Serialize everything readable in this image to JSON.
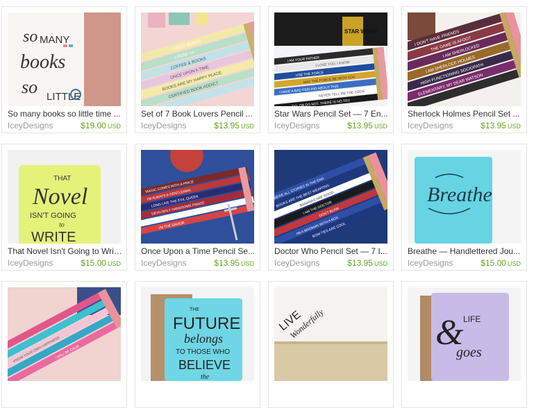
{
  "listings": [
    {
      "title": "So many books so little time ...",
      "shop": "IceyDesigns",
      "price": "$19.00",
      "currency": "USD",
      "thumb_text": [
        "so",
        "MANY",
        "books",
        "so",
        "LITTLE"
      ]
    },
    {
      "title": "Set of 7 Book Lovers Pencil ...",
      "shop": "IceyDesigns",
      "price": "$13.95",
      "currency": "USD",
      "thumb_text": [
        "I NEED BOOKS",
        "I READ YA",
        "COFFEE & BOOKS",
        "ONCE UPON A TIME",
        "BOOKS ARE MY HAPPY PLACE",
        "CERTIFIED BOOK ADDICT"
      ]
    },
    {
      "title": "Star Wars Pencil Set — 7 En...",
      "shop": "IceyDesigns",
      "price": "$13.95",
      "currency": "USD",
      "thumb_text": [
        "I AM YOUR FATHER",
        "I LOVE YOU. I KNOW",
        "USE THE FORCE",
        "MAY THE FORCE BE WITH YOU",
        "I HAVE A BAD FEELING ABOUT THIS",
        "NEVER TELL ME THE ODDS",
        "DO. OR DO NOT. THERE IS NO TRY.",
        "STAR WARS"
      ]
    },
    {
      "title": "Sherlock Holmes Pencil Set ...",
      "shop": "IceyDesigns",
      "price": "$13.95",
      "currency": "USD",
      "thumb_text": [
        "I DON'T HAVE FRIENDS",
        "THE GAME IS AFOOT",
        "I AM SHERLOCKED",
        "I AM SHERLOCK HOLMES",
        "HIGH FUNCTIONING SOCIOPATH",
        "ELEMENTARY, MY DEAR WATSON"
      ]
    },
    {
      "title": "That Novel Isn't Going to Writ...",
      "shop": "IceyDesigns",
      "price": "$15.00",
      "currency": "USD",
      "thumb_text": [
        "THAT",
        "Novel",
        "ISN'T GOING",
        "to",
        "WRITE"
      ]
    },
    {
      "title": "Once Upon a Time Pencil Se...",
      "shop": "IceyDesigns",
      "price": "$13.95",
      "currency": "USD",
      "thumb_text": [
        "MAGIC COMES WITH A PRICE",
        "I'M ALWAYS A GENTLEMAN",
        "LONG LIVE THE EVIL QUEEN",
        "DEVILISHLY HANDSOME PIRATE",
        "I'M THE SAVIOR"
      ]
    },
    {
      "title": "Doctor Who Pencil Set — 7 I...",
      "shop": "IceyDesigns",
      "price": "$13.95",
      "currency": "USD",
      "thumb_text": [
        "WE'RE ALL STORIES IN THE END",
        "BOOKS ARE THE BEST WEAPONS",
        "BANANAS ARE GOOD",
        "I AM THE DOCTOR",
        "DON'T BLINK",
        "I'M A MADMAN WITH A BOX",
        "BOW TIES ARE COOL"
      ]
    },
    {
      "title": "Breathe — Handlettered Jou...",
      "shop": "IceyDesigns",
      "price": "$15.00",
      "currency": "USD",
      "thumb_text": [
        "Breathe"
      ]
    },
    {
      "title": "",
      "shop": "",
      "price": "",
      "currency": "",
      "thumb_text": [
        "KNOW YOUR OWN HAPPINESS",
        "I WILL BE CALM"
      ]
    },
    {
      "title": "",
      "shop": "",
      "price": "",
      "currency": "",
      "thumb_text": [
        "THE",
        "FUTURE",
        "belongs",
        "TO THOSE WHO",
        "BELIEVE",
        "the"
      ]
    },
    {
      "title": "",
      "shop": "",
      "price": "",
      "currency": "",
      "thumb_text": [
        "LIVE",
        "Wonderfully"
      ]
    },
    {
      "title": "",
      "shop": "",
      "price": "",
      "currency": "",
      "thumb_text": [
        "&",
        "LIFE",
        "goes"
      ]
    }
  ]
}
